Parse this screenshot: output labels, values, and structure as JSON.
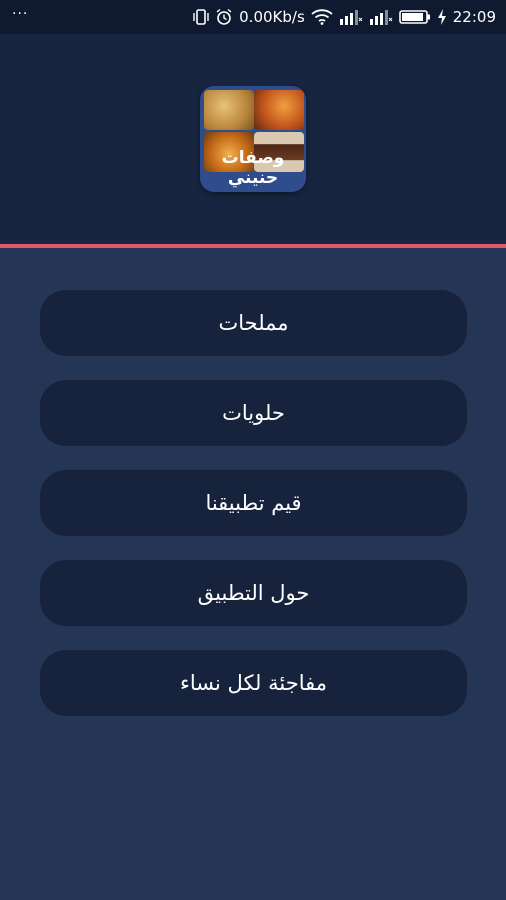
{
  "status_bar": {
    "left_indicator": "···",
    "network_speed": "0.00Kb/s",
    "time": "22:09",
    "icons": [
      "vibrate-icon",
      "alarm-icon",
      "wifi-icon",
      "signal-icon",
      "signal-icon",
      "battery-icon",
      "charging-icon"
    ]
  },
  "app": {
    "logo_text": "وصفات حنيني"
  },
  "menu": {
    "items": [
      {
        "label": "مملحات"
      },
      {
        "label": "حلويات"
      },
      {
        "label": "قيم تطبيقنا"
      },
      {
        "label": "حول التطبيق"
      },
      {
        "label": "مفاجئة لكل نساء"
      }
    ]
  },
  "colors": {
    "background": "#243556",
    "header": "#172540",
    "accent_line": "#e0586a",
    "button": "#17233d",
    "status_bar": "#0f1a30"
  }
}
